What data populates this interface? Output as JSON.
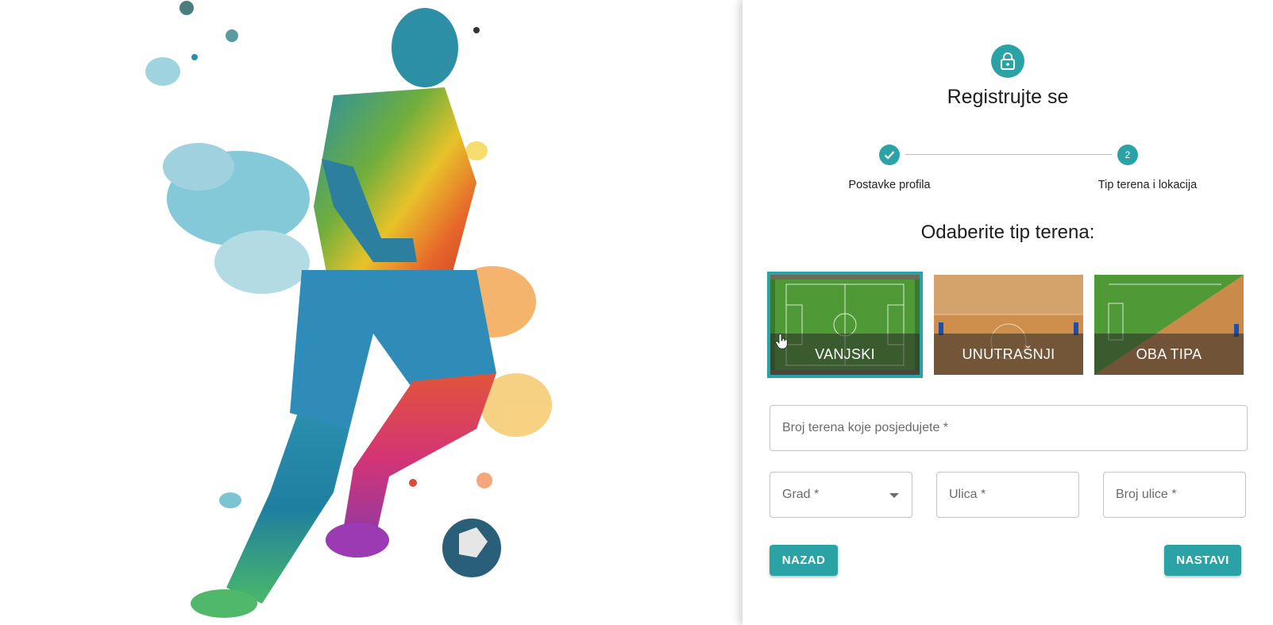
{
  "header": {
    "title": "Registrujte se"
  },
  "stepper": {
    "steps": [
      {
        "label": "Postavke profila",
        "state": "completed"
      },
      {
        "label": "Tip terena i lokacija",
        "number": "2",
        "state": "active"
      }
    ]
  },
  "section": {
    "subtitle": "Odaberite tip terena:"
  },
  "field_types": [
    {
      "label": "VANJSKI",
      "selected": true
    },
    {
      "label": "UNUTRAŠNJI",
      "selected": false
    },
    {
      "label": "OBA TIPA",
      "selected": false
    }
  ],
  "form": {
    "courts_count": {
      "label": "Broj terena koje posjedujete *",
      "value": ""
    },
    "city": {
      "label": "Grad *",
      "value": ""
    },
    "street": {
      "label": "Ulica *",
      "value": ""
    },
    "street_number": {
      "label": "Broj ulice *",
      "value": ""
    }
  },
  "buttons": {
    "back": "NAZAD",
    "next": "NASTAVI"
  },
  "icons": {
    "lock": "lock-icon",
    "check": "check-icon",
    "dropdown": "chevron-down-icon",
    "cursor": "hand-pointer-icon"
  },
  "colors": {
    "accent": "#2ba3a6"
  }
}
